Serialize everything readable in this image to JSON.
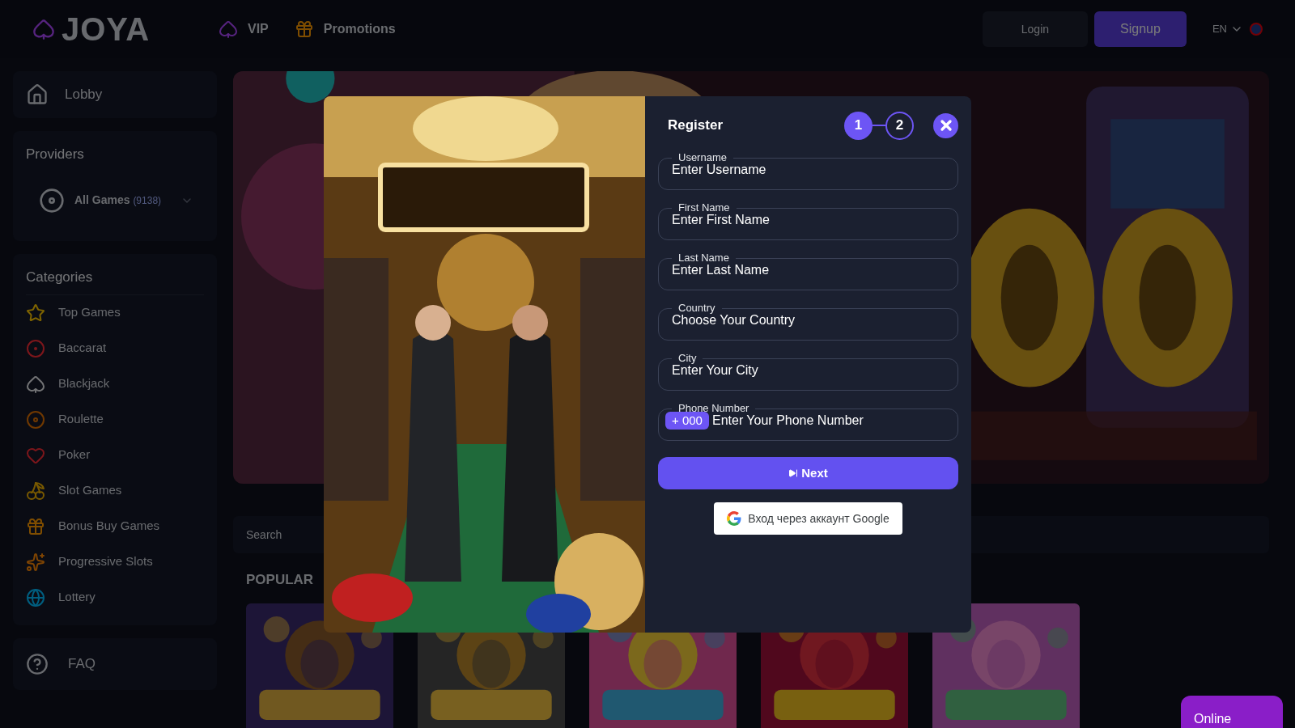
{
  "header": {
    "logo": "JOYA",
    "nav": [
      {
        "label": "VIP"
      },
      {
        "label": "Promotions"
      }
    ],
    "login": "Login",
    "signup": "Signup",
    "language": "EN"
  },
  "sidebar": {
    "lobby": "Lobby",
    "providers_title": "Providers",
    "provider": {
      "label": "All Games",
      "count": "(9138)"
    },
    "categories_title": "Categories",
    "categories": [
      {
        "label": "Top Games"
      },
      {
        "label": "Baccarat"
      },
      {
        "label": "Blackjack"
      },
      {
        "label": "Roulette"
      },
      {
        "label": "Poker"
      },
      {
        "label": "Slot Games"
      },
      {
        "label": "Bonus Buy Games"
      },
      {
        "label": "Progressive Slots"
      },
      {
        "label": "Lottery"
      }
    ],
    "faq": "FAQ"
  },
  "main": {
    "search": {
      "placeholder": "Search"
    },
    "section_title": "POPULAR"
  },
  "modal": {
    "title": "Register",
    "steps": [
      {
        "label": "1",
        "selected": true
      },
      {
        "label": "2",
        "selected": false
      }
    ],
    "fields": [
      {
        "label": "Username",
        "placeholder": "Enter Username"
      },
      {
        "label": "First Name",
        "placeholder": "Enter First Name"
      },
      {
        "label": "Last Name",
        "placeholder": "Enter Last Name"
      },
      {
        "label": "Country",
        "placeholder": "Choose Your Country"
      },
      {
        "label": "City",
        "placeholder": "Enter Your City"
      },
      {
        "label": "Phone Number",
        "prefix": "+ 000",
        "placeholder": "Enter Your Phone Number"
      }
    ],
    "next": "Next",
    "google": "Вход через аккаунт Google"
  },
  "chat": "Online"
}
